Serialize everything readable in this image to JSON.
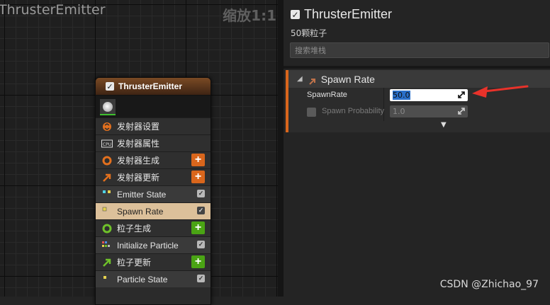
{
  "graph": {
    "title": "ThrusterEmitter",
    "zoom": "缩放1:1"
  },
  "node": {
    "title": "ThrusterEmitter",
    "rows": [
      {
        "label": "发射器设置",
        "icon": "emitter-settings-icon"
      },
      {
        "label": "发射器属性",
        "icon": "cpu-icon"
      },
      {
        "label": "发射器生成",
        "icon": "spawn-ring-icon",
        "action": "+"
      },
      {
        "label": "发射器更新",
        "icon": "update-arrow-icon",
        "action": "+"
      },
      {
        "label": "Emitter State"
      },
      {
        "label": "Spawn Rate"
      },
      {
        "label": "粒子生成",
        "icon": "particle-spawn-icon",
        "action": "+"
      },
      {
        "label": "Initialize Particle"
      },
      {
        "label": "粒子更新",
        "icon": "particle-update-icon",
        "action": "+"
      },
      {
        "label": "Particle State"
      }
    ],
    "check_mark": "✓",
    "plus_label": "+"
  },
  "details": {
    "title": "ThrusterEmitter",
    "particle_count": "50颗粒子",
    "search_placeholder": "搜索堆栈",
    "section": {
      "title": "Spawn Rate",
      "props": [
        {
          "name": "SpawnRate",
          "value": "50.0"
        },
        {
          "name": "Spawn Probability",
          "value": "1.0"
        }
      ]
    }
  },
  "colors": {
    "accent_orange": "#d9661c",
    "accent_green": "#4aa414",
    "selected_row": "#dcc09a",
    "annotation_red": "#e8322a"
  },
  "watermark": "CSDN @Zhichao_97"
}
